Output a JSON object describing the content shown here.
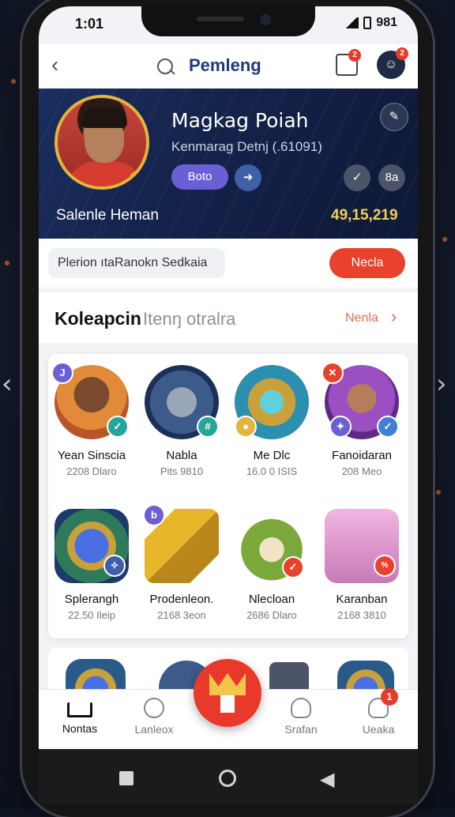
{
  "status": {
    "time": "1:01",
    "right": "981"
  },
  "header": {
    "title": "Pemleng",
    "inbox_badge": "2",
    "avatar_badge": "2"
  },
  "profile": {
    "name": "Magkag Poiah",
    "subtitle": "Kenmarag Detnj (.61091)",
    "pill_label": "Boto",
    "footer_left": "Salenle Heman",
    "footer_right": "49,15,219",
    "right_circle_label": "8a"
  },
  "search": {
    "placeholder": "Plerion ıtaRanokn Sedkaia",
    "button": "Necla"
  },
  "section": {
    "title": "Koleapcin",
    "subtitle": "Itenŋ otralra",
    "more": "Nenla"
  },
  "items": [
    {
      "name": "Yean Sinscia",
      "value": "2208 Dlaro"
    },
    {
      "name": "Nabla",
      "value": "Pits 9810"
    },
    {
      "name": "Me Dlc",
      "value": "16.0 0 ISIS"
    },
    {
      "name": "Fanoidaran",
      "value": "208 Meo"
    },
    {
      "name": "Splerangh",
      "value": "22.50 Ileip"
    },
    {
      "name": "Prodenleon.",
      "value": "2168 3eon"
    },
    {
      "name": "Nlecloan",
      "value": "2686 Dlaro"
    },
    {
      "name": "Karanban",
      "value": "2168 3810"
    }
  ],
  "nav": [
    {
      "label": "Nontas"
    },
    {
      "label": "Lanleox"
    },
    {
      "label": "Srafan"
    },
    {
      "label": "Ueaka",
      "badge": "1"
    }
  ],
  "colors": {
    "accent": "#e8412c",
    "brand": "#1f3b7a",
    "gold": "#e2b53c",
    "purple": "#6b5fd6"
  }
}
